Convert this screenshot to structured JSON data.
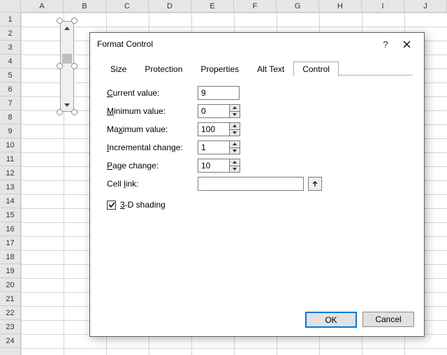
{
  "sheet": {
    "columns": [
      "A",
      "B",
      "C",
      "D",
      "E",
      "F",
      "G",
      "H",
      "I",
      "J"
    ],
    "rows": [
      "1",
      "2",
      "3",
      "4",
      "5",
      "6",
      "7",
      "8",
      "9",
      "10",
      "11",
      "12",
      "13",
      "14",
      "15",
      "16",
      "17",
      "18",
      "19",
      "20",
      "21",
      "22",
      "23",
      "24"
    ]
  },
  "dialog": {
    "title": "Format Control",
    "help_label": "?",
    "tabs": [
      "Size",
      "Protection",
      "Properties",
      "Alt Text",
      "Control"
    ],
    "active_tab": "Control",
    "labels": {
      "current_value": {
        "pre": "",
        "u": "C",
        "post": "urrent value:"
      },
      "minimum_value": {
        "pre": "",
        "u": "M",
        "post": "inimum value:"
      },
      "maximum_value": {
        "pre": "Ma",
        "u": "x",
        "post": "imum value:"
      },
      "incremental_change": {
        "pre": "",
        "u": "I",
        "post": "ncremental change:"
      },
      "page_change": {
        "pre": "",
        "u": "P",
        "post": "age change:"
      },
      "cell_link": {
        "pre": "Cell ",
        "u": "l",
        "post": "ink:"
      },
      "shading": {
        "pre": "",
        "u": "3",
        "post": "-D shading"
      }
    },
    "values": {
      "current_value": "9",
      "minimum_value": "0",
      "maximum_value": "100",
      "incremental_change": "1",
      "page_change": "10",
      "cell_link": ""
    },
    "shading_checked": true,
    "buttons": {
      "ok": "OK",
      "cancel": "Cancel"
    }
  }
}
